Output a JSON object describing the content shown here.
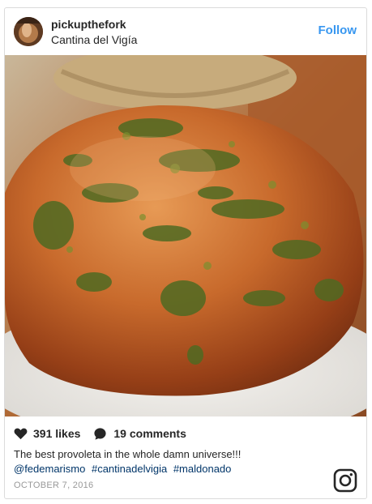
{
  "post": {
    "username": "pickupthefork",
    "location": "Cantina del Vigía",
    "follow_label": "Follow",
    "likes": "391 likes",
    "comments": "19 comments",
    "caption": "The best provoleta in the whole damn universe!!!",
    "tags": [
      "@fedemarismo",
      "#cantinadelvigia",
      "#maldonado"
    ],
    "date": "OCTOBER 7, 2016"
  },
  "icons": {
    "avatar": "avatar-food-photo",
    "like": "heart-icon",
    "comment": "speech-bubble-icon",
    "brand": "instagram-logo-icon"
  },
  "colors": {
    "follow": "#3897f0",
    "text": "#262626",
    "tags": "#003569",
    "date": "#999999",
    "border": "#dbdbdb"
  }
}
